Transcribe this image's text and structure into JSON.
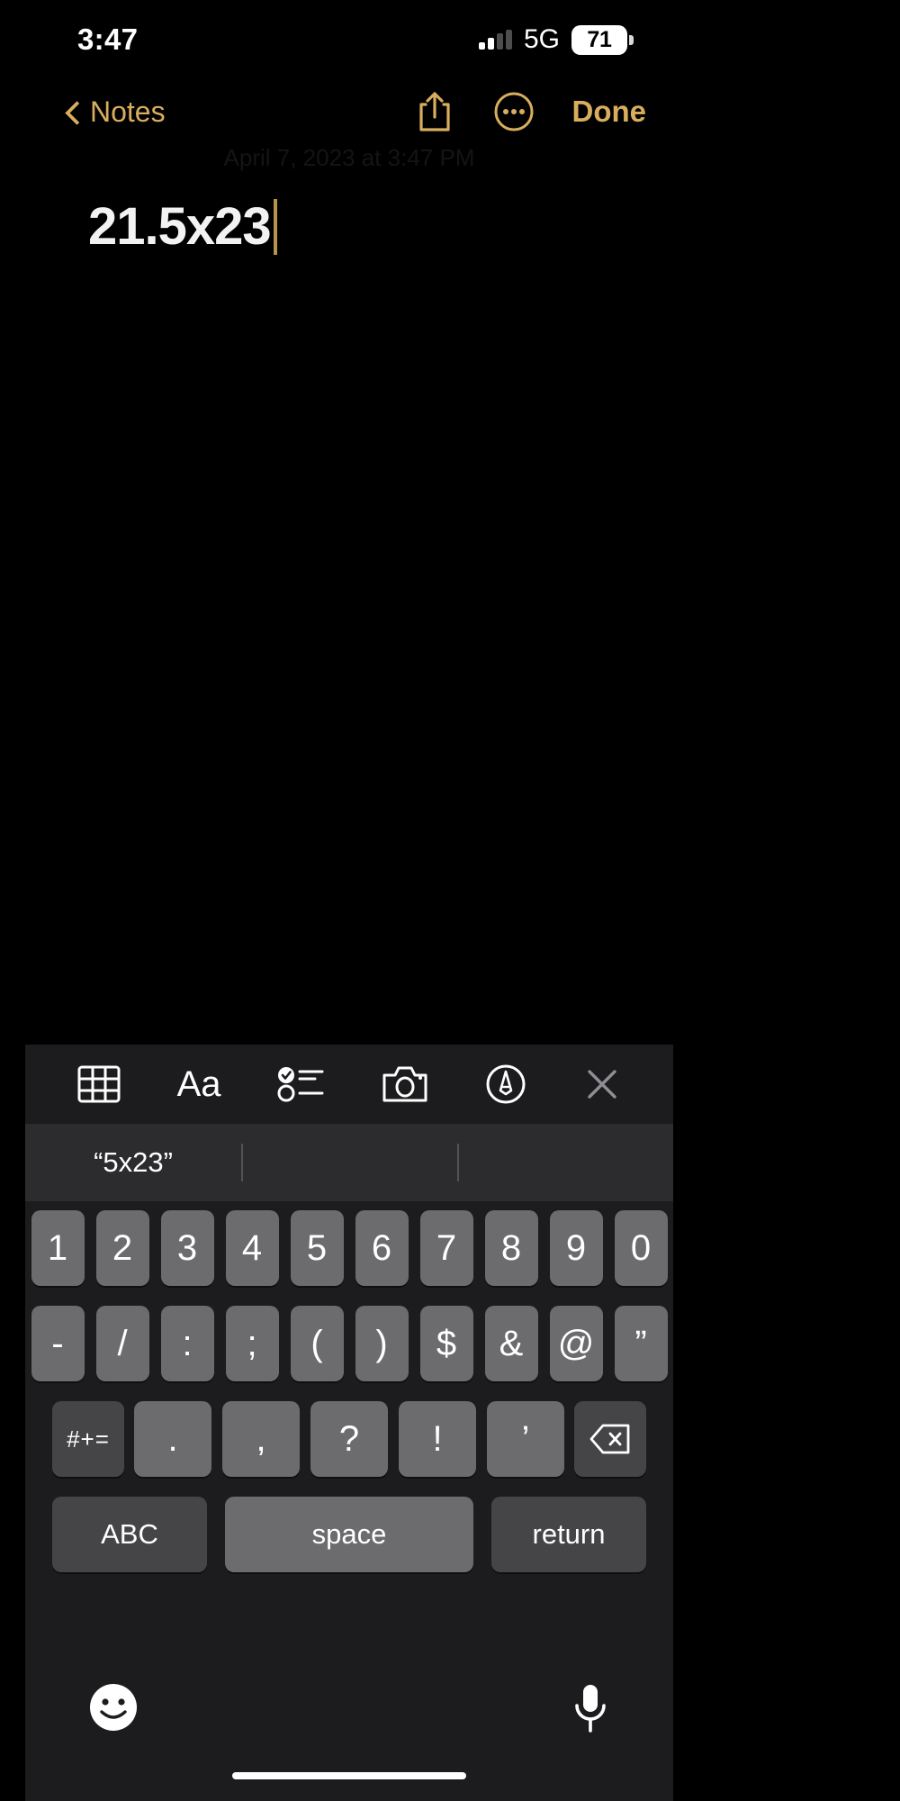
{
  "status_bar": {
    "time": "3:47",
    "network": "5G",
    "battery_level": "71",
    "signal_icon": "cellular-signal-icon",
    "battery_icon": "battery-icon"
  },
  "nav_bar": {
    "back_label": "Notes",
    "back_icon": "chevron-left-icon",
    "share_icon": "share-up-arrow-icon",
    "more_icon": "ellipsis-circle-icon",
    "done_label": "Done"
  },
  "note": {
    "date": "April 7, 2023 at 3:47 PM",
    "title": "21.5x23",
    "caret": "text-cursor"
  },
  "format_bar": {
    "items": [
      {
        "name": "table-icon",
        "label": ""
      },
      {
        "name": "text-format-icon",
        "label": "Aa"
      },
      {
        "name": "checklist-icon",
        "label": ""
      },
      {
        "name": "camera-icon",
        "label": ""
      },
      {
        "name": "markup-pen-icon",
        "label": ""
      },
      {
        "name": "close-icon",
        "label": ""
      }
    ]
  },
  "predictive_bar": {
    "suggestions": [
      "“5x23”",
      "",
      ""
    ]
  },
  "keyboard": {
    "number_row": [
      "1",
      "2",
      "3",
      "4",
      "5",
      "6",
      "7",
      "8",
      "9",
      "0"
    ],
    "symbol_row": [
      "-",
      "/",
      ":",
      ";",
      "(",
      ")",
      "$",
      "&",
      "@",
      "”"
    ],
    "punct_row": {
      "shift_label": "#+=",
      "keys": [
        ".",
        ",",
        "?",
        "!",
        "’"
      ],
      "backspace_icon": "backspace-delete-icon"
    },
    "bottom_row": {
      "abc_label": "ABC",
      "space_label": "space",
      "return_label": "return"
    },
    "emoji_icon": "emoji-smiley-icon",
    "mic_icon": "microphone-icon",
    "home_indicator": "home-indicator"
  },
  "colors": {
    "accent_gold": "#d8ae5e",
    "keyboard_bg": "#1c1c1e",
    "key_bg": "#6c6c6e",
    "key_dark_bg": "#454547",
    "predictive_bg": "#2c2c2e"
  }
}
